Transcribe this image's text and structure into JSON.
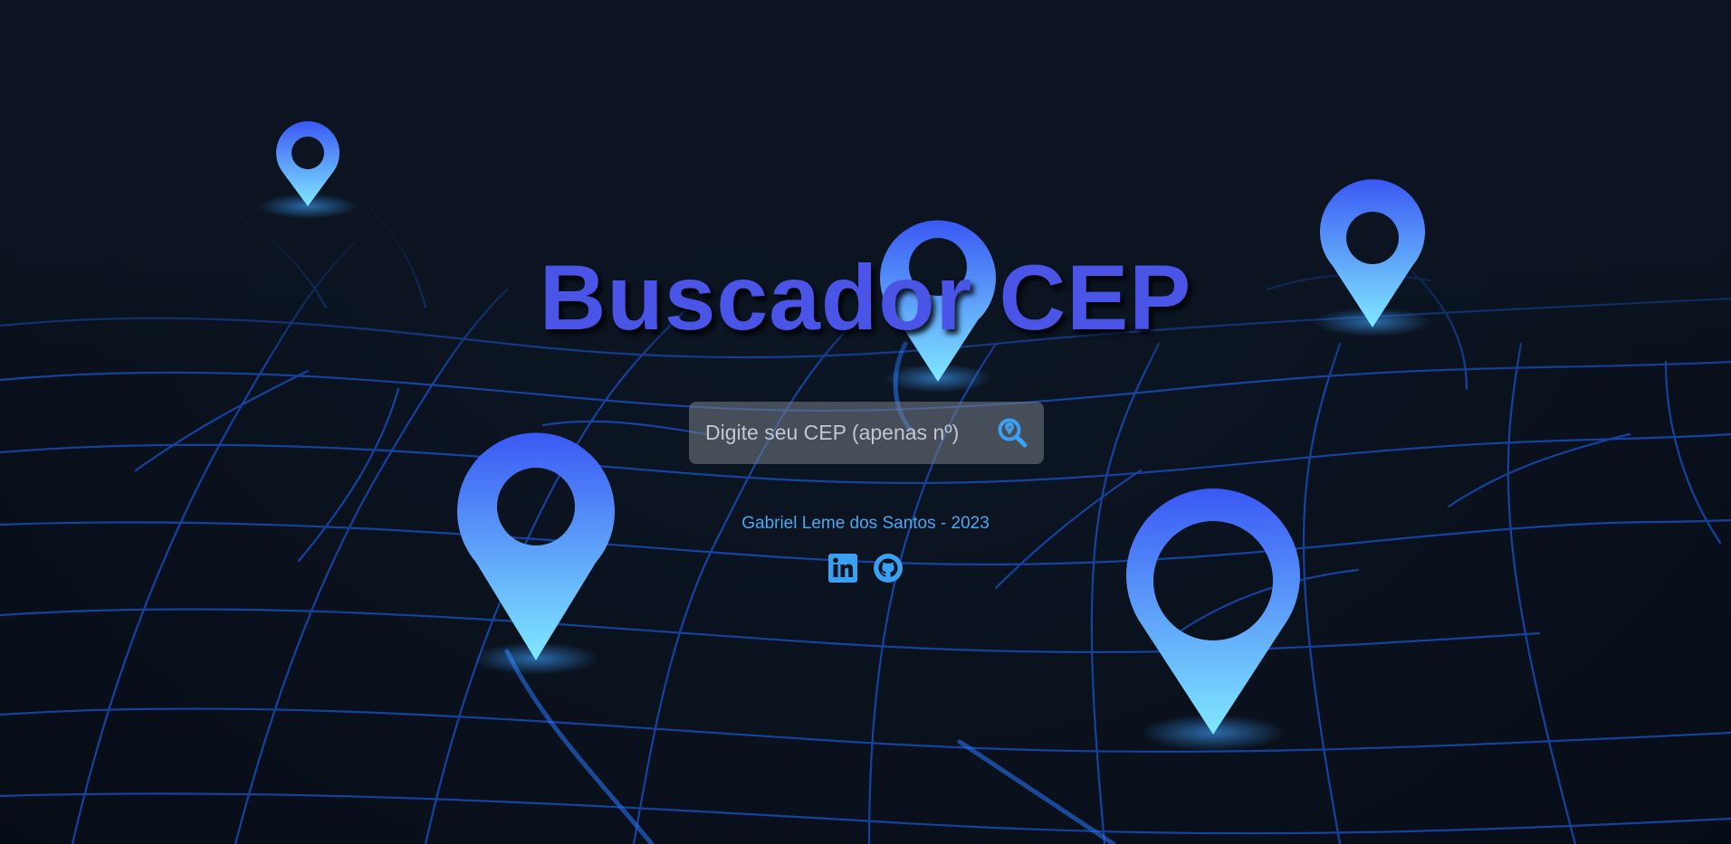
{
  "page": {
    "title": "Buscador CEP"
  },
  "search": {
    "placeholder": "Digite seu CEP (apenas nº)",
    "value": "",
    "button_icon": "search-location-icon"
  },
  "footer": {
    "author": "Gabriel Leme dos Santos - 2023",
    "links": [
      {
        "icon": "linkedin-icon"
      },
      {
        "icon": "github-icon"
      }
    ]
  },
  "colors": {
    "background": "#0a1320",
    "title": "#4a55e8",
    "accent": "#4aa8f0",
    "pin_top": "#3c5cf5",
    "pin_bottom": "#7ae2ff",
    "road": "#1a53c8"
  }
}
